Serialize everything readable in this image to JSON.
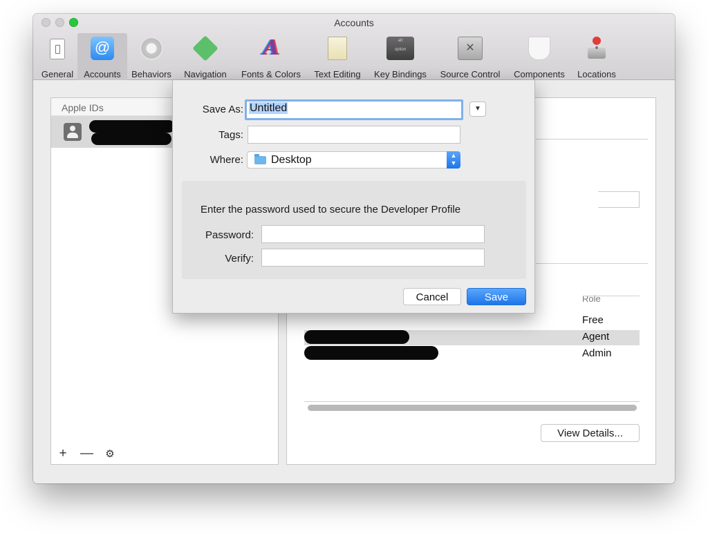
{
  "window": {
    "title": "Accounts"
  },
  "toolbar": {
    "items": [
      {
        "label": "General",
        "icon": "general-icon"
      },
      {
        "label": "Accounts",
        "icon": "at-sign-icon",
        "glyph": "@"
      },
      {
        "label": "Behaviors",
        "icon": "gear-icon"
      },
      {
        "label": "Navigation",
        "icon": "navigation-arrows-icon",
        "glyph": "✥"
      },
      {
        "label": "Fonts & Colors",
        "icon": "fonts-colors-icon",
        "glyph": "A"
      },
      {
        "label": "Text Editing",
        "icon": "text-editing-icon"
      },
      {
        "label": "Key Bindings",
        "icon": "keyboard-key-icon",
        "key_top": "alt",
        "key_bottom": "option"
      },
      {
        "label": "Source Control",
        "icon": "source-control-icon"
      },
      {
        "label": "Components",
        "icon": "components-icon"
      },
      {
        "label": "Locations",
        "icon": "joystick-icon"
      }
    ],
    "selected": "Accounts"
  },
  "sidebar": {
    "header": "Apple IDs",
    "footer": {
      "add": "+",
      "remove": "—",
      "gear": "⚙"
    }
  },
  "detail": {
    "role_header": "Role",
    "roles": [
      "Free",
      "Agent",
      "Admin"
    ],
    "view_details_label": "View Details..."
  },
  "save_sheet": {
    "save_as_label": "Save As:",
    "save_as_value": "Untitled",
    "tags_label": "Tags:",
    "tags_value": "",
    "where_label": "Where:",
    "where_value": "Desktop",
    "password_message": "Enter the password used to secure the Developer Profile",
    "password_label": "Password:",
    "verify_label": "Verify:",
    "cancel_label": "Cancel",
    "save_label": "Save"
  },
  "colors": {
    "accent": "#1d75ea",
    "selection": "#b3d4fc",
    "focus_ring": "#7fb0ea",
    "zoom_button": "#27c93f"
  }
}
